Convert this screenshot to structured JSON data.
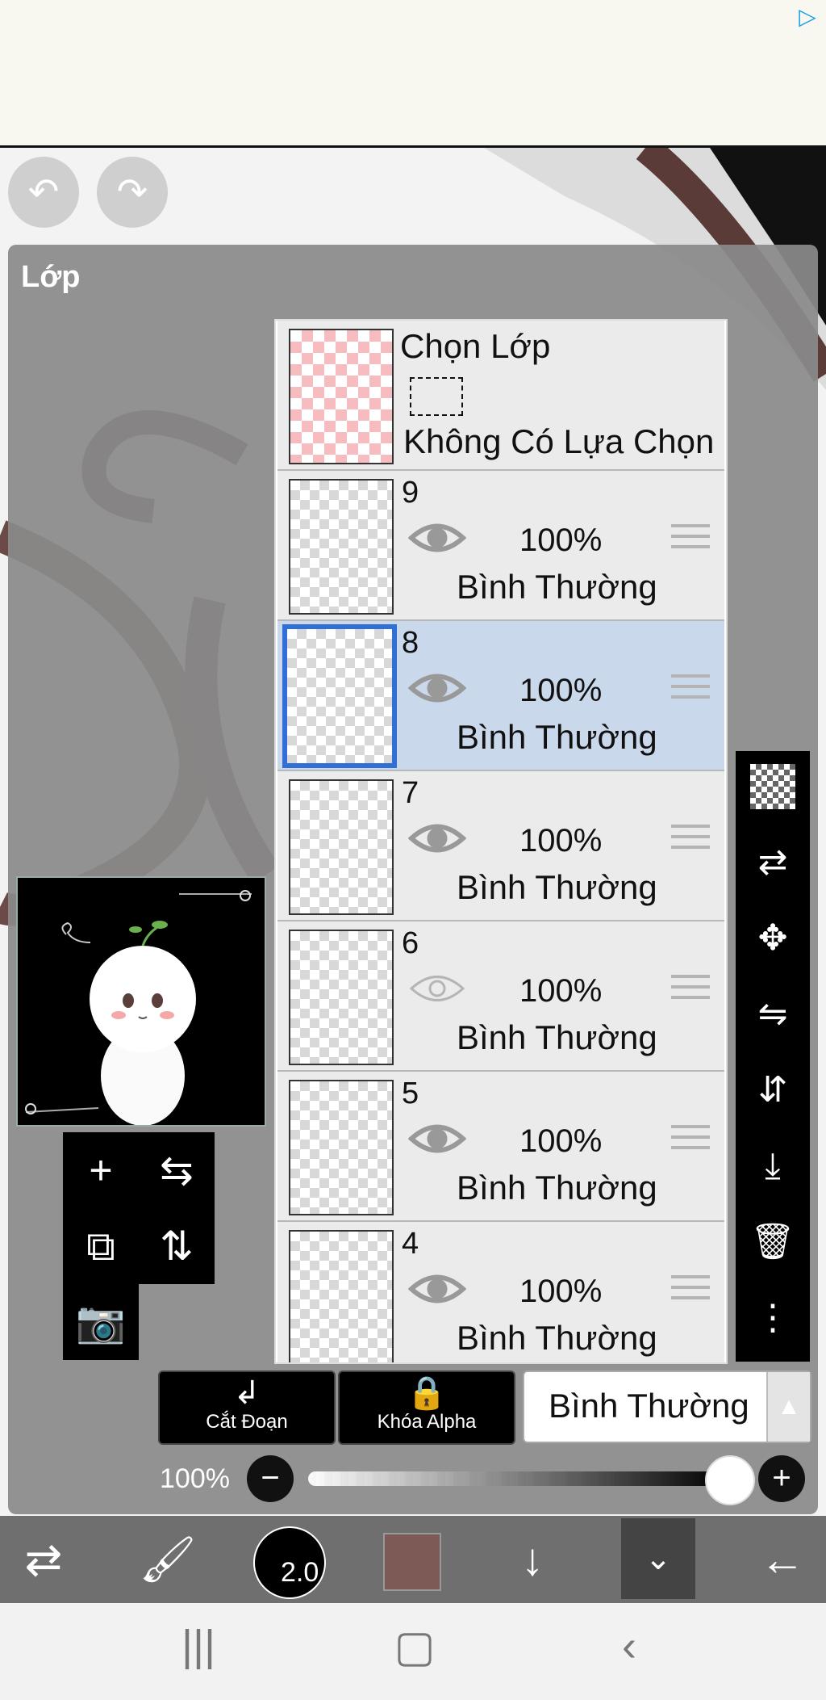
{
  "app": {
    "panel_title": "Lớp",
    "accent_color": "#2f6fd6"
  },
  "ad": {
    "icon": "ad-choices-icon"
  },
  "history": {
    "undo_icon": "undo-icon",
    "redo_icon": "redo-icon"
  },
  "selection_layer": {
    "title": "Chọn Lớp",
    "status": "Không Có Lựa Chọn"
  },
  "layers": [
    {
      "number": "9",
      "opacity": "100%",
      "blend": "Bình Thường",
      "visible": true,
      "selected": false
    },
    {
      "number": "8",
      "opacity": "100%",
      "blend": "Bình Thường",
      "visible": true,
      "selected": true
    },
    {
      "number": "7",
      "opacity": "100%",
      "blend": "Bình Thường",
      "visible": true,
      "selected": false
    },
    {
      "number": "6",
      "opacity": "100%",
      "blend": "Bình Thường",
      "visible": false,
      "selected": false
    },
    {
      "number": "5",
      "opacity": "100%",
      "blend": "Bình Thường",
      "visible": true,
      "selected": false
    },
    {
      "number": "4",
      "opacity": "100%",
      "blend": "Bình Thường",
      "visible": true,
      "selected": false
    }
  ],
  "controls": {
    "cut_label": "Cắt Đoạn",
    "alpha_lock_label": "Khóa Alpha",
    "blend_mode": "Bình Thường",
    "opacity": "100%",
    "opacity_value": 1.0
  },
  "toolbar": {
    "brush_size": "2.0",
    "color": "#7d5a55"
  }
}
